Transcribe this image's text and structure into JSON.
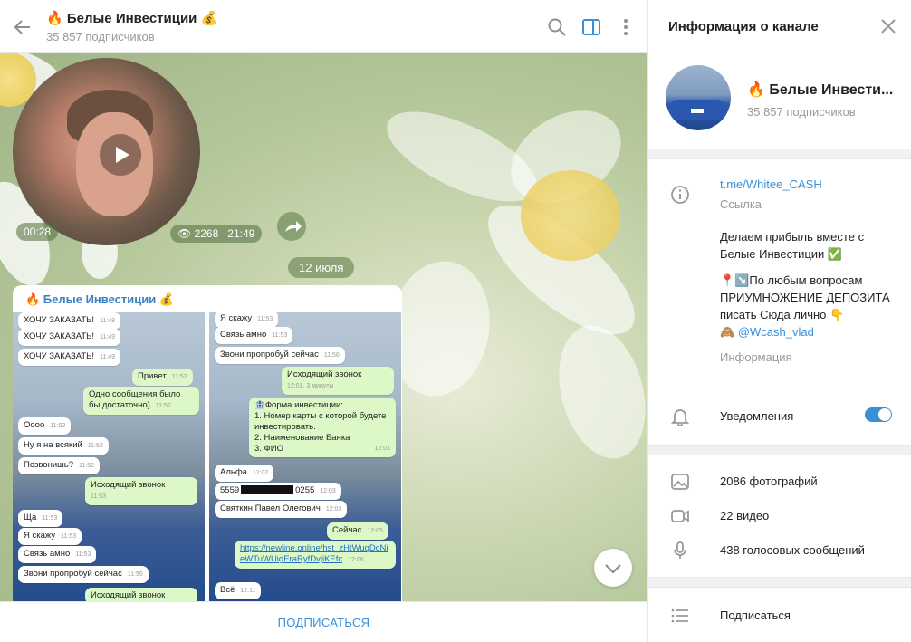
{
  "chat": {
    "title": "🔥 Белые Инвестиции 💰",
    "subscribers": "35 857 подписчиков",
    "video": {
      "duration": "00:28",
      "views": "2268",
      "time": "21:49"
    },
    "date_divider": "12 июля",
    "post": {
      "title": "🔥 Белые Инвестиции 💰",
      "screenshot_left": [
        {
          "text": "ХОЧУ ЗАКАЗАТЬ!",
          "time": "11:48",
          "dir": "in"
        },
        {
          "text": "ХОЧУ ЗАКАЗАТЬ!",
          "time": "11:49",
          "dir": "in"
        },
        {
          "text": "ХОЧУ ЗАКАЗАТЬ!",
          "time": "11:49",
          "dir": "in"
        },
        {
          "text": "Привет",
          "time": "11:52",
          "dir": "out"
        },
        {
          "text": "Одно сообщения было бы достаточно)",
          "time": "11:52",
          "dir": "out"
        },
        {
          "text": "Оооо",
          "time": "11:52",
          "dir": "in"
        },
        {
          "text": "Ну я на всякий",
          "time": "11:52",
          "dir": "in"
        },
        {
          "text": "Позвонишь?",
          "time": "11:52",
          "dir": "in"
        },
        {
          "text": "Исходящий звонок",
          "time": "11:53",
          "dir": "out"
        },
        {
          "text": "Ща",
          "time": "11:53",
          "dir": "in"
        },
        {
          "text": "Я скажу",
          "time": "11:53",
          "dir": "in"
        },
        {
          "text": "Связь амно",
          "time": "11:53",
          "dir": "in"
        },
        {
          "text": "Звони пропробуй сейчас",
          "time": "11:56",
          "dir": "in"
        },
        {
          "text": "Исходящий звонок",
          "time": "",
          "dir": "out"
        }
      ],
      "screenshot_right": [
        {
          "text": "Я скажу",
          "time": "11:53",
          "dir": "in"
        },
        {
          "text": "Связь амно",
          "time": "11:53",
          "dir": "in"
        },
        {
          "text": "Звони пропробуй сейчас",
          "time": "11:56",
          "dir": "in"
        },
        {
          "text": "Исходящий звонок",
          "time": "12:01, 3 минуты",
          "dir": "out"
        },
        {
          "text": "🏦Форма инвестиции:",
          "time": "",
          "dir": "out"
        },
        {
          "text": "1. Номер карты с которой будете инвестировать.",
          "time": "",
          "dir": "out"
        },
        {
          "text": "2. Наименование Банка",
          "time": "",
          "dir": "out"
        },
        {
          "text": "3. ФИО",
          "time": "12:01",
          "dir": "out"
        },
        {
          "text": "Альфа",
          "time": "12:02",
          "dir": "in"
        },
        {
          "text": "5559",
          "tail": "0255",
          "time": "12:03",
          "dir": "in"
        },
        {
          "text": "Святкин Павел Олегович",
          "time": "12:03",
          "dir": "in"
        },
        {
          "text": "Сейчас",
          "time": "12:05",
          "dir": "out"
        },
        {
          "text": "https://newline.online/hst_zHtWuqDcNieWTuWUigEraRyfDvjiKEfc",
          "time": "12:06",
          "dir": "out"
        },
        {
          "text": "Всё",
          "time": "12:11",
          "dir": "in"
        }
      ]
    },
    "subscribe_label": "ПОДПИСАТЬСЯ"
  },
  "info": {
    "title": "Информация о канале",
    "name": "🔥 Белые Инвести...",
    "subscribers": "35 857 подписчиков",
    "link": "t.me/Whitee_CASH",
    "link_caption": "Ссылка",
    "description_line1": "Делаем прибыль вместе с Белые Инвестиции ✅",
    "description_line2": "📍↘️По любым вопросам ПРИУМНОЖЕНИЕ ДЕПОЗИТА писать Сюда лично 👇",
    "description_mention_prefix": "🙈",
    "description_mention": "@Wcash_vlad",
    "description_caption": "Информация",
    "notifications_label": "Уведомления",
    "notifications_on": true,
    "photos": "2086 фотографий",
    "videos": "22 видео",
    "voice": "438 голосовых сообщений",
    "subscribers_row": "Подписаться"
  },
  "colors": {
    "accent": "#3a8fd9",
    "post_title": "#3a7fc1",
    "out_bubble": "#dcf8c6"
  }
}
